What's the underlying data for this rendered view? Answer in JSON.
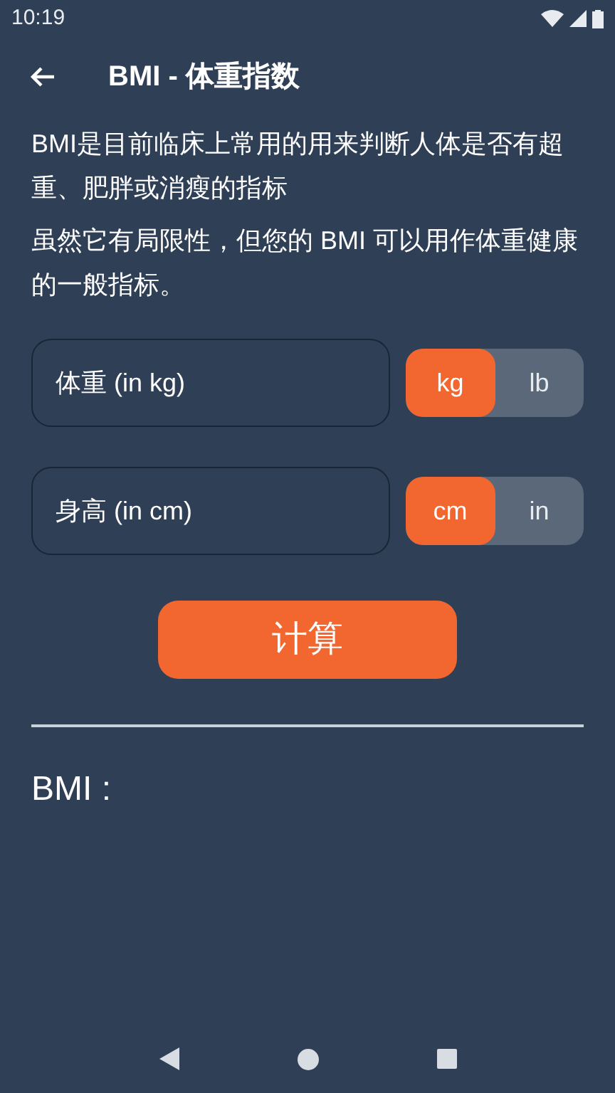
{
  "status_bar": {
    "time": "10:19"
  },
  "header": {
    "title": "BMI - 体重指数"
  },
  "intro": [
    "BMI是目前临床上常用的用来判断人体是否有超重、肥胖或消瘦的指标",
    "虽然它有局限性，但您的 BMI 可以用作体重健康的一般指标。"
  ],
  "inputs": [
    {
      "placeholder": "体重 (in kg)",
      "units": [
        {
          "label": "kg",
          "selected": true
        },
        {
          "label": "lb",
          "selected": false
        }
      ]
    },
    {
      "placeholder": "身高 (in cm)",
      "units": [
        {
          "label": "cm",
          "selected": true
        },
        {
          "label": "in",
          "selected": false
        }
      ]
    }
  ],
  "calculate_button": "计算",
  "result_label": "BMI :"
}
